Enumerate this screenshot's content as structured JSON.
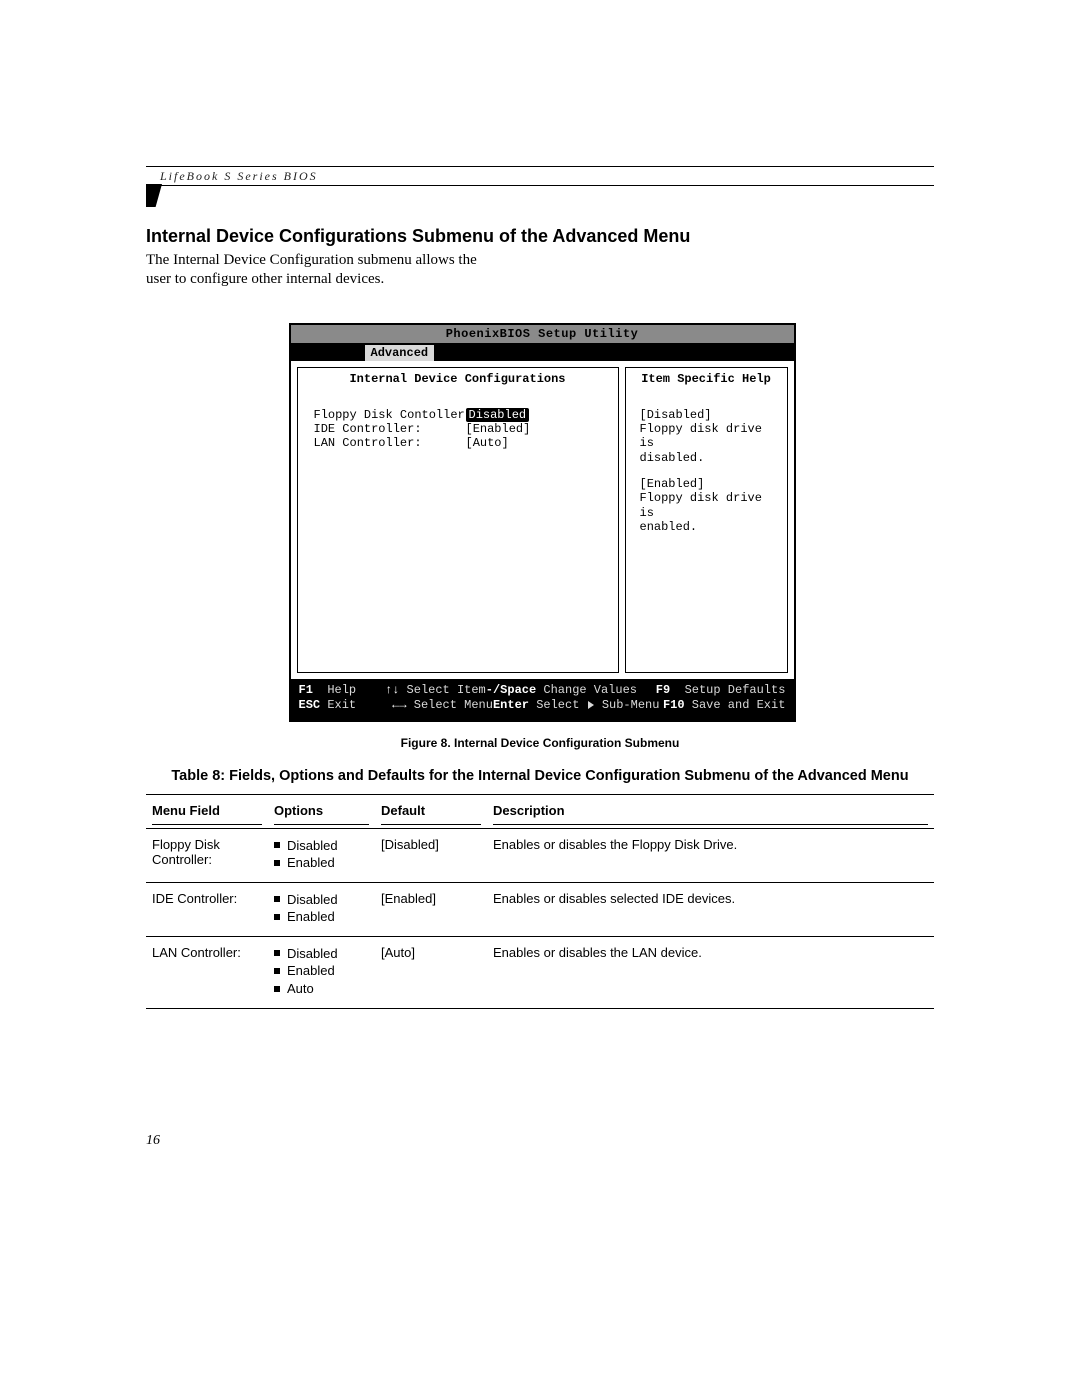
{
  "header_text": "LifeBook S Series BIOS",
  "section_title": "Internal Device Configurations Submenu of the Advanced Menu",
  "intro_line1": "The Internal Device Configuration submenu allows the",
  "intro_line2": "user to configure other internal devices.",
  "bios": {
    "title": "PhoenixBIOS Setup Utility",
    "active_tab": "Advanced",
    "left_title": "Internal Device Configurations",
    "right_title": "Item Specific Help",
    "fields": [
      {
        "label": "Floppy Disk Contoller:",
        "value": "Disabled",
        "selected": true
      },
      {
        "label": "IDE Controller:",
        "value": "[Enabled]",
        "selected": false
      },
      {
        "label": "LAN Controller:",
        "value": "[Auto]",
        "selected": false
      }
    ],
    "help": {
      "h1": "[Disabled]",
      "h2": "Floppy disk drive is",
      "h3": "disabled.",
      "h4": "[Enabled]",
      "h5": "Floppy disk drive is",
      "h6": "enabled."
    },
    "footer": {
      "f1_key": "F1",
      "f1": "Help",
      "updown": "↑↓",
      "updown_txt": "Select Item",
      "minus_key": "-/Space",
      "minus_txt": "Change Values",
      "f9_key": "F9",
      "f9": "Setup Defaults",
      "esc_key": "ESC",
      "esc": "Exit",
      "lr": "←→",
      "lr_txt": "Select Menu",
      "enter_key": "Enter",
      "enter_txt_a": "Select",
      "enter_txt_b": "Sub-Menu",
      "f10_key": "F10",
      "f10": "Save and Exit"
    }
  },
  "figure_caption": "Figure 8. Internal Device Configuration Submenu",
  "table_caption": "Table 8: Fields, Options and Defaults for the Internal Device Configuration Submenu of the Advanced Menu",
  "table": {
    "headers": {
      "c1": "Menu Field",
      "c2": "Options",
      "c3": "Default",
      "c4": "Description"
    },
    "rows": [
      {
        "field": "Floppy Disk Controller:",
        "options": [
          "Disabled",
          "Enabled"
        ],
        "default": "[Disabled]",
        "desc": "Enables or disables the Floppy Disk Drive."
      },
      {
        "field": "IDE Controller:",
        "options": [
          "Disabled",
          "Enabled"
        ],
        "default": "[Enabled]",
        "desc": "Enables or disables selected IDE devices."
      },
      {
        "field": "LAN Controller:",
        "options": [
          "Disabled",
          "Enabled",
          "Auto"
        ],
        "default": "[Auto]",
        "desc": "Enables or disables the LAN device."
      }
    ]
  },
  "page_number": "16"
}
